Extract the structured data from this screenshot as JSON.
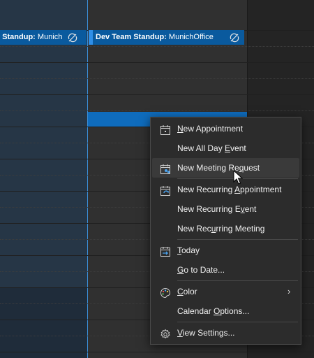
{
  "appointments": {
    "left": {
      "bold": "y Standup:",
      "location": " Munich"
    },
    "middle": {
      "bold": "Dev Team Standup:",
      "location": " MunichOffice"
    },
    "recurring_icon": "recurring-exception-icon"
  },
  "colors": {
    "appointment": "#0a5a9e",
    "selection": "#0f6cbd",
    "today_line": "#3b8fd9",
    "menu_bg": "#2c2c2c"
  },
  "context_menu": {
    "items": [
      {
        "pre": "",
        "u": "N",
        "post": "ew Appointment",
        "icon": "calendar-icon"
      },
      {
        "pre": "New All Day ",
        "u": "E",
        "post": "vent",
        "icon": ""
      },
      {
        "pre": "New Meeting Re",
        "u": "q",
        "post": "uest",
        "icon": "meeting-request-icon"
      },
      {
        "pre": "New Recurring ",
        "u": "A",
        "post": "ppointment",
        "icon": "recurring-appointment-icon"
      },
      {
        "pre": "New Recurring E",
        "u": "v",
        "post": "ent",
        "icon": ""
      },
      {
        "pre": "New Rec",
        "u": "u",
        "post": "rring Meeting",
        "icon": ""
      },
      {
        "pre": "",
        "u": "T",
        "post": "oday",
        "icon": "today-icon"
      },
      {
        "pre": "",
        "u": "G",
        "post": "o to Date...",
        "icon": ""
      },
      {
        "pre": "",
        "u": "C",
        "post": "olor",
        "icon": "color-palette-icon",
        "submenu": "›"
      },
      {
        "pre": "Calendar ",
        "u": "O",
        "post": "ptions...",
        "icon": ""
      },
      {
        "pre": "",
        "u": "V",
        "post": "iew Settings...",
        "icon": "gear-icon"
      }
    ]
  }
}
